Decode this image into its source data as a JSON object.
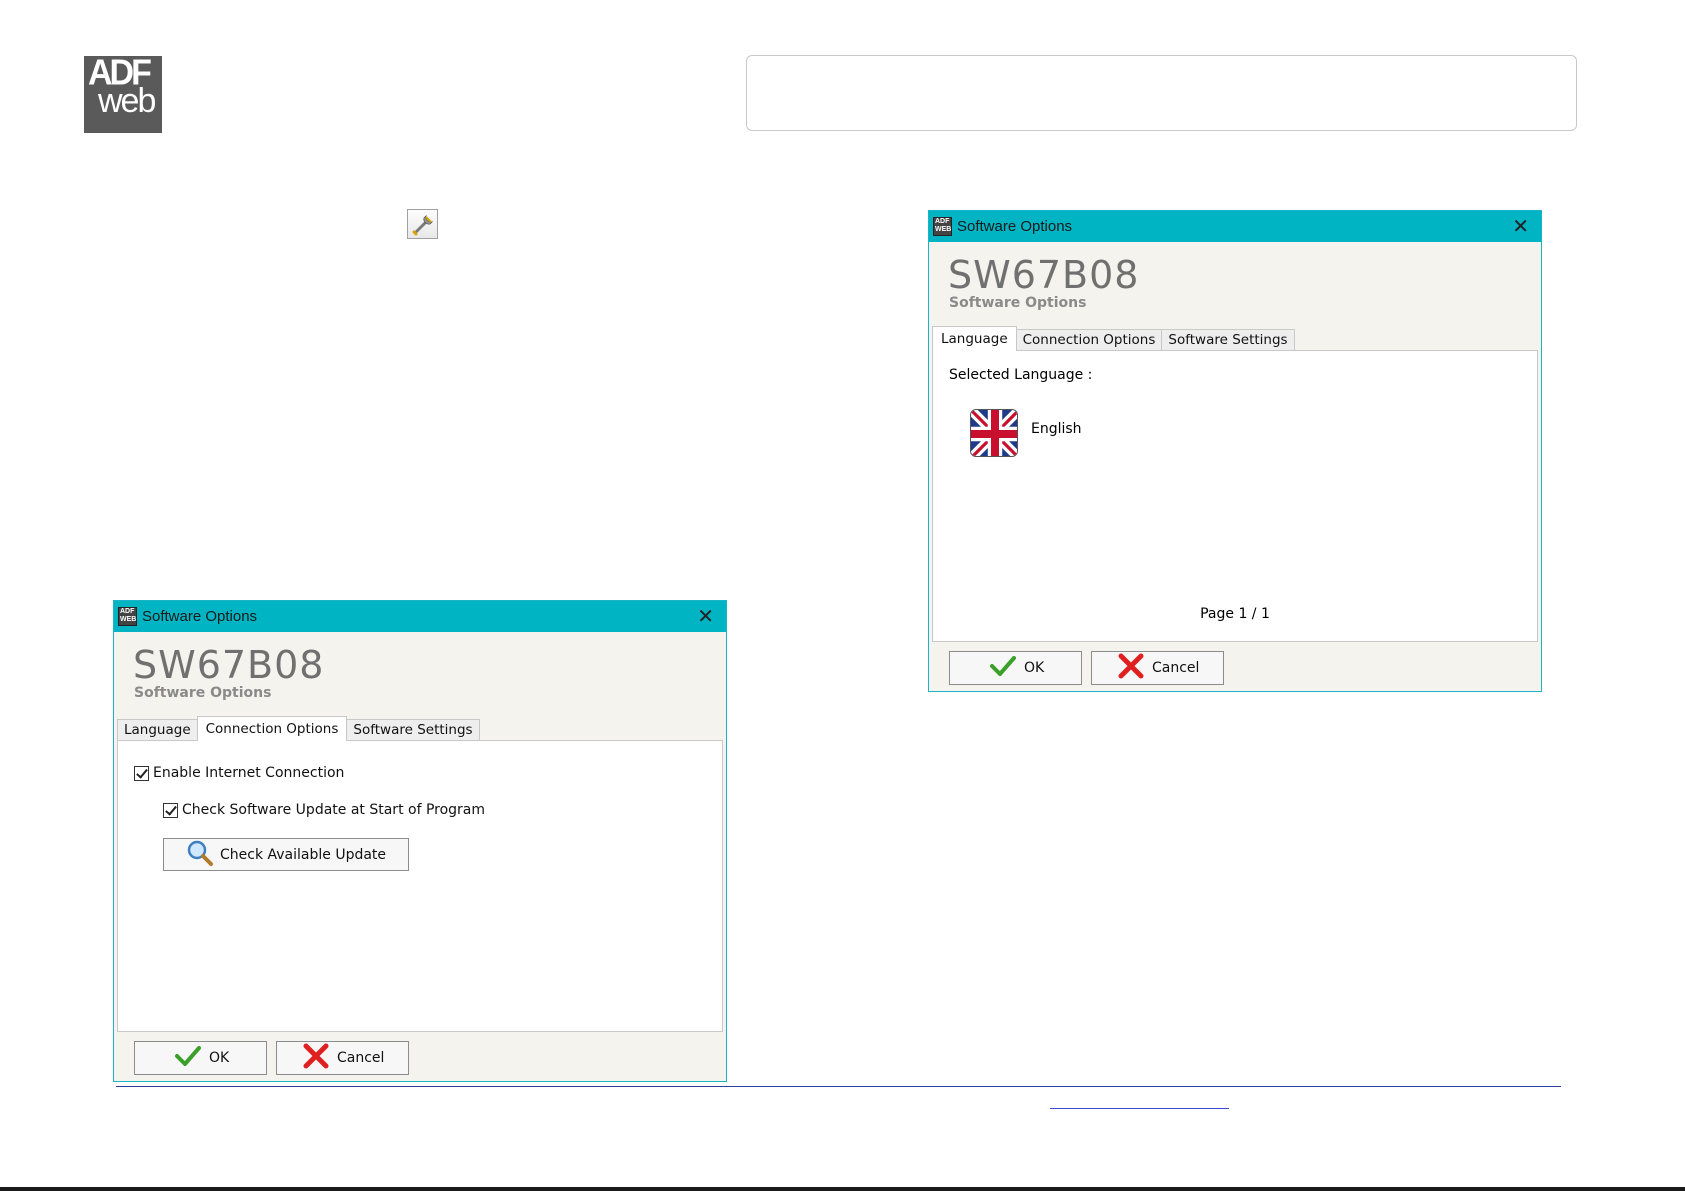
{
  "logo": {
    "line1": "ADF",
    "line2": "web"
  },
  "dialog_right": {
    "title": "Software Options",
    "close": "✕",
    "heading": "SW67B08",
    "subheading": "Software Options",
    "tabs": [
      "Language",
      "Connection Options",
      "Software Settings"
    ],
    "active_tab": "Language",
    "selected_language_label": "Selected Language :",
    "language": "English",
    "page": "Page 1 / 1",
    "ok": "OK",
    "cancel": "Cancel"
  },
  "dialog_left": {
    "title": "Software Options",
    "close": "✕",
    "heading": "SW67B08",
    "subheading": "Software Options",
    "tabs": [
      "Language",
      "Connection Options",
      "Software Settings"
    ],
    "active_tab": "Connection Options",
    "enable_internet": "Enable Internet Connection",
    "check_update_start": "Check Software Update at Start of Program",
    "check_available": "Check Available Update",
    "ok": "OK",
    "cancel": "Cancel"
  },
  "colors": {
    "titlebar": "#00b4c4",
    "footer_line": "#2a3e9a"
  },
  "icons": [
    "wrench-icon",
    "uk-flag-icon",
    "check-icon",
    "x-icon",
    "magnifier-icon"
  ]
}
